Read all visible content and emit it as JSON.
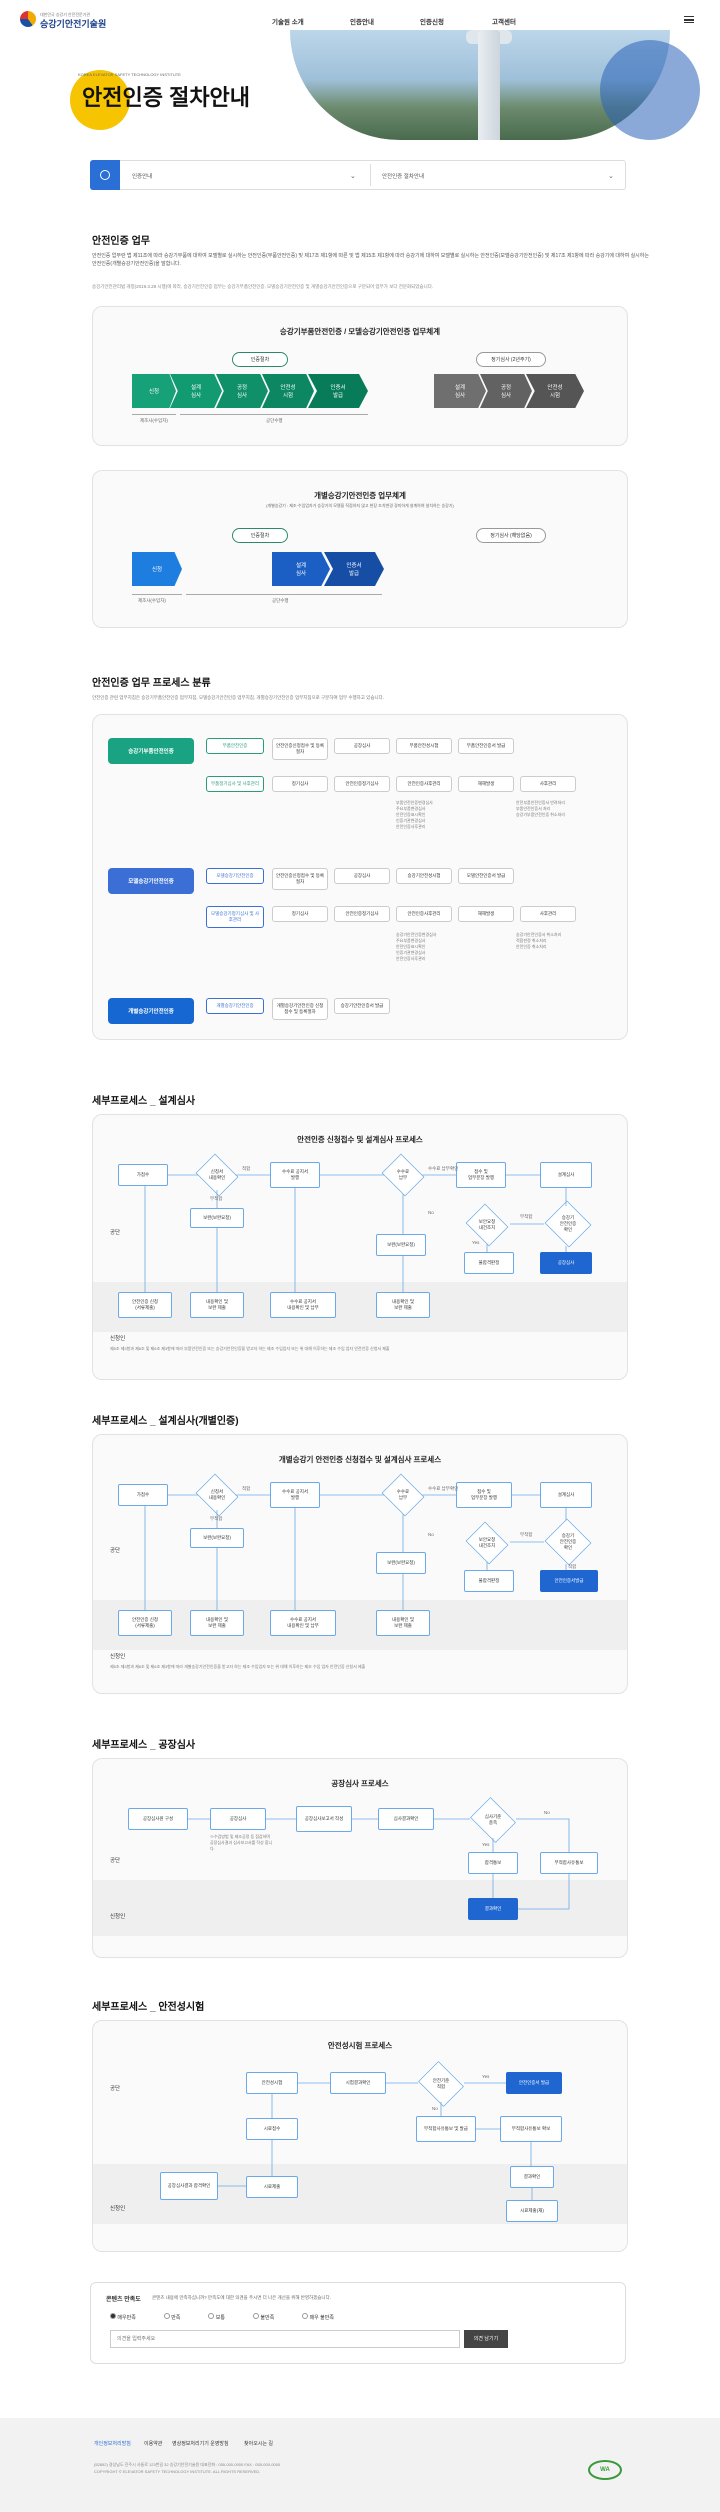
{
  "header": {
    "logo_small": "대한민국 승강기 안전전문기관",
    "logo_main": "승강기안전기술원",
    "nav": [
      "기술원 소개",
      "인증안내",
      "인증신청",
      "고객센터"
    ]
  },
  "hero": {
    "eng": "KOREA ELEVATOR SAFETY TECHNOLOGY INSTITUTE",
    "title": "안전인증 절차안내"
  },
  "breadcrumb": {
    "sel1": "인증안내",
    "sel2": "안전인증 절차안내"
  },
  "sec1": {
    "title": "안전인증 업무",
    "body": "안전인증 업무란 법 제11조에 따라 승강기부품에 대하여 모델별로 실시하는 안전인증(부품안전인증) 및 제17조 제1항에 따른 및 법 제15조 제1항에 따라 승강기에 대하여 모델별로 실시하는 안전인증(모델승강기안전인증) 및 제17조 제1항에 따라 승강기에 대하여 실시하는 안전인증(개별승강기안전인증)을 말합니다.",
    "note": "승강기안전관리법 개정(2019.3.28 시행)에 따라, 승강기안전인증 업무는 승강기부품안전인증, 모델승강기안전인증 및 개별승강기안전인증으로 구분되어 업무가 보다 전문화되었습니다."
  },
  "flow1": {
    "title": "승강기부품안전인증 / 모델승강기안전인증 업무체계",
    "cert_label": "인증절차",
    "regular_label": "정기심사 (2년주기)",
    "steps": [
      "신청",
      "설계\n심사",
      "공정\n심사",
      "안전성\n시험",
      "인증서\n발급"
    ],
    "steps2": [
      "설계\n심사",
      "공정\n심사",
      "안전성\n시험"
    ],
    "sub1": "제조사(수입자)",
    "sub2": "공단수행"
  },
  "flow2": {
    "title": "개별승강기안전인증 업무체계",
    "note": "(개별승강기 : 제조·수입업자가 승강기의 모델을 직접하지 않고 현장 조치변경 경미하게 설계하여 설치하는 승강기)",
    "cert_label": "인증절차",
    "regular_label": "정기심사 (해당없음)",
    "steps": [
      "신청",
      "설계\n심사",
      "인증서\n발급"
    ],
    "sub1": "제조사(수입자)",
    "sub2": "공단수행"
  },
  "sec2": {
    "title": "안전인증 업무 프로세스 분류",
    "note": "안전인증 관련 업무지침은 승강기부품안전인증 업무지침, 모델승강기안전인증 업무지침, 개별승강기안전인증 업무지침으로 구분하여 업무 수행하고 있습니다.",
    "cats": [
      "승강기부품안전인증",
      "모델승강기안전인증",
      "개별승강기안전인증"
    ],
    "row1a": [
      "부품안전인증",
      "안전인증신청접수 및 등록절차",
      "공장심사",
      "부품안전성시험",
      "부품안전인증서 발급"
    ],
    "row1b": [
      "부품정기심사 및 사후관리",
      "정기심사",
      "안전인증정기심사",
      "안전인증사후관리",
      "재해발생",
      "사후관리"
    ],
    "list1": [
      "부품안전인증변경심사",
      "주요부품변경심사",
      "안전인증표시확인",
      "인증기관변경심사",
      "안전인증사후관리"
    ],
    "list1b": [
      "안전부품안전인증서 반려처리",
      "부품안전인증서 처리",
      "승강기부품안전인증 취소처리"
    ],
    "row2a": [
      "모델승강기안전인증",
      "안전인증신청접수 및 등록절차",
      "공장심사",
      "승강기안전성시험",
      "모델안전인증서 발급"
    ],
    "row2b": [
      "모델승강기정기심사 및 사후관리",
      "정기심사",
      "안전인증정기심사",
      "안전인증사후관리",
      "재해발생",
      "사후관리"
    ],
    "list2": [
      "승강기안전인증변경심사",
      "주요부품변경심사",
      "안전인증표시확인",
      "인증기관변경심사",
      "안전인증사후관리"
    ],
    "list2b": [
      "승강기안전인증서 취소처리",
      "적합판정 취소처리",
      "안전인증 취소처리"
    ],
    "row3": [
      "개별승강기안전인증",
      "개별승강기안전인증 신청접수 및 등록절차",
      "승강기안전인증서 발급"
    ]
  },
  "proc1": {
    "title": "세부프로세스 _ 설계심사",
    "box": "안전인증 신청접수 및 설계심사 프로세스",
    "lane1": "공단",
    "lane2": "신청인",
    "desc": "제5조 제3항과 제6조 및 제6조 제3항에 따라 부품안전인증 또는 승강기안전인증을 받고자 하는 제조 수입업자 또는 위 대해 이후하는 제조 수입 업자 안전인증 신청서 제출"
  },
  "proc2": {
    "title": "세부프로세스 _ 설계심사(개별인증)",
    "box": "개별승강기 안전인증 신청접수 및 설계심사 프로세스",
    "lane1": "공단",
    "lane2": "신청인",
    "desc": "제5조 제3항과 제6조 및 제6조 제3항에 따라 개별승강기안전인증을 받고자 하는 제조 수입업자 또는 위 대해 이후하는 제조 수입 업자 안전인증 신청서 제출"
  },
  "flow_nodes": {
    "receive": "가접수",
    "submit": "안전인증 신청\n(서류제출)",
    "check": "신청서\n내용확인",
    "fit": "적합",
    "unfit": "부적합",
    "supp": "보완(보완요청)",
    "doc": "내용확인 및\n보완 제출",
    "fee_req": "수수료 공지서\n발행",
    "fee_pay": "수수료 공지서\n내용확인 및 납부",
    "paid": "수수료\n납부",
    "accept": "접수 및\n업무분장 발행",
    "design": "설계심사",
    "fee_chk": "수수료\n납부확인",
    "doc2": "내용확인 및\n보완 제출",
    "rev": "보안요청\n내건조치",
    "cert_ok": "승강기\n안전인증\n확인",
    "unfit_n": "불합격판정",
    "factory": "공장심사",
    "issue": "안전인증서발급",
    "yes": "Yes",
    "no": "No"
  },
  "proc3": {
    "title": "세부프로세스 _ 공장심사",
    "box": "공장심사 프로세스",
    "lane1": "공단",
    "lane2": "신청인",
    "nodes": [
      "공장심사원 구성",
      "공장심사",
      "공장심사보고서 작성",
      "심사결과확인",
      "심사기준\n충족",
      "합격통보",
      "부적합사유통보",
      "결과확인"
    ],
    "note": "※수검방법 및 제조공정 등 점검하며 공장심사결과 심사보고서를 작성 합니다.",
    "yes": "Yes",
    "no": "No"
  },
  "proc4": {
    "title": "세부프로세스 _ 안전성시험",
    "box": "안전성시험 프로세스",
    "lane1": "공단",
    "lane2": "신청인",
    "nodes": [
      "안전성시험",
      "시험결과확인",
      "안전기준\n적합",
      "안전인증서 발급",
      "시료접수",
      "부적합사유통보 및 발급",
      "부적합사유통보 확보",
      "시료제출",
      "공장심사결과 합격확인",
      "결과확인",
      "시료제출(재)"
    ],
    "yes": "Yes",
    "no": "No"
  },
  "survey": {
    "title": "콘텐츠 만족도",
    "q": "콘텐츠 내용에 만족하십니까? 만족도에 대한 의견을 주시면 더 나은 개선을 위해 반영하겠습니다.",
    "options": [
      "매우만족",
      "만족",
      "보통",
      "불만족",
      "매우 불만족"
    ],
    "placeholder": "의견을 입력주세요",
    "submit": "의견 남기기"
  },
  "footer": {
    "links": [
      "개인정보처리방침",
      "이용약관",
      "영상정보처리기기 운영방침",
      "찾아오시는 길"
    ],
    "addr": "(52852) 경상남도 진주시 사들로 123번길 32 승강기안전기술원 대표전화 : 055-000-0000 FAX : 055-000-0000\nCOPYRIGHT © ELEVATOR SAFETY TECHNOLOGY INSTITUTE. ALL RIGHTS RESERVED.",
    "badge": "WA"
  }
}
